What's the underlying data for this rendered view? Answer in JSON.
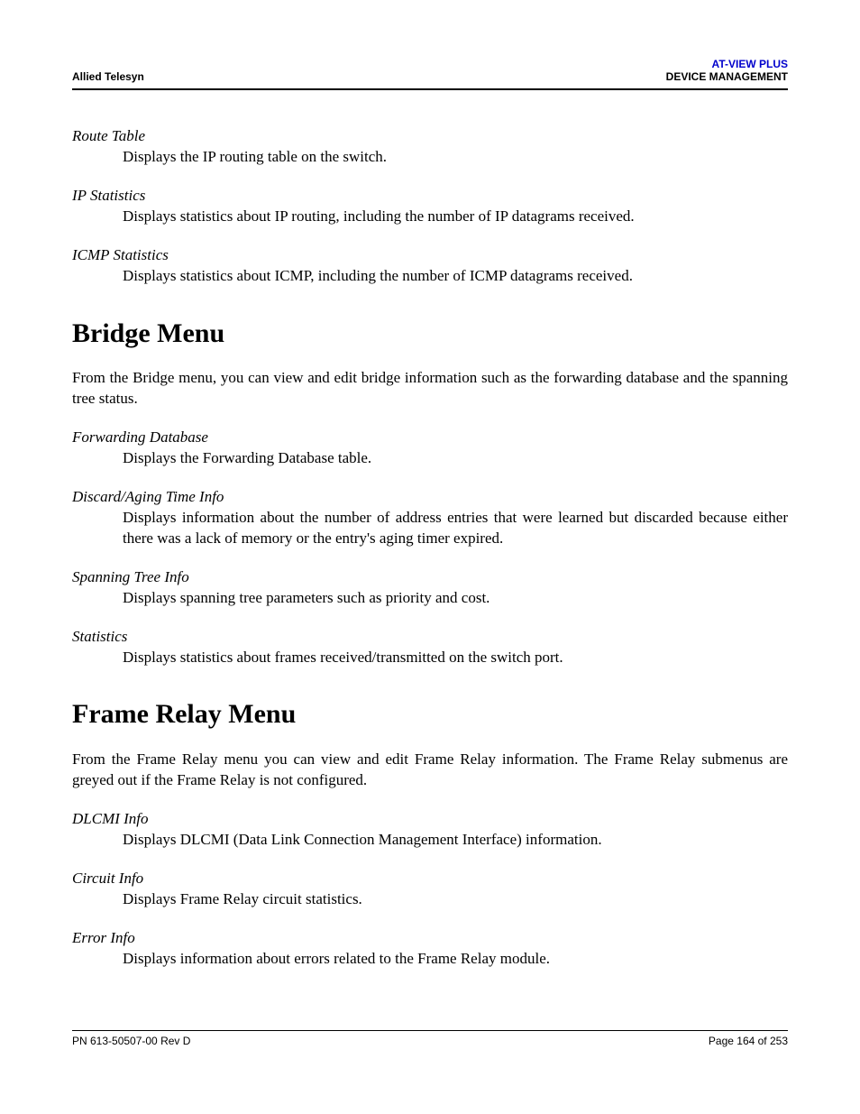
{
  "header": {
    "left": "Allied Telesyn",
    "right_title": "AT-VIEW PLUS",
    "right_subtitle": "DEVICE MANAGEMENT"
  },
  "sections": {
    "preamble_items": [
      {
        "term": "Route Table",
        "def": "Displays the IP routing table on the switch."
      },
      {
        "term": "IP Statistics",
        "def": "Displays statistics about IP routing, including the number of IP datagrams received."
      },
      {
        "term": "ICMP Statistics",
        "def": "Displays statistics about ICMP, including the number of ICMP datagrams received."
      }
    ],
    "bridge": {
      "heading": "Bridge Menu",
      "intro": "From the Bridge menu, you can view and edit bridge information such as the forwarding database and the spanning tree status.",
      "items": [
        {
          "term": "Forwarding Database",
          "def": "Displays the Forwarding Database table."
        },
        {
          "term": "Discard/Aging Time Info",
          "def": "Displays information about the number of address entries that were learned but discarded because either there was a lack of memory or the entry's aging timer expired."
        },
        {
          "term": "Spanning Tree Info",
          "def": "Displays spanning tree parameters such as priority and cost."
        },
        {
          "term": "Statistics",
          "def": "Displays statistics about frames received/transmitted on the switch port."
        }
      ]
    },
    "frame_relay": {
      "heading": "Frame Relay Menu",
      "intro": "From the Frame Relay menu you can view and edit Frame Relay information. The Frame Relay submenus are greyed out if the Frame Relay is not configured.",
      "items": [
        {
          "term": "DLCMI Info",
          "def": "Displays DLCMI (Data Link Connection Management Interface) information."
        },
        {
          "term": "Circuit Info",
          "def": "Displays Frame Relay circuit statistics."
        },
        {
          "term": "Error Info",
          "def": "Displays information about errors related to the Frame Relay module."
        }
      ]
    }
  },
  "footer": {
    "left": "PN 613-50507-00 Rev D",
    "right": "Page 164 of 253"
  }
}
